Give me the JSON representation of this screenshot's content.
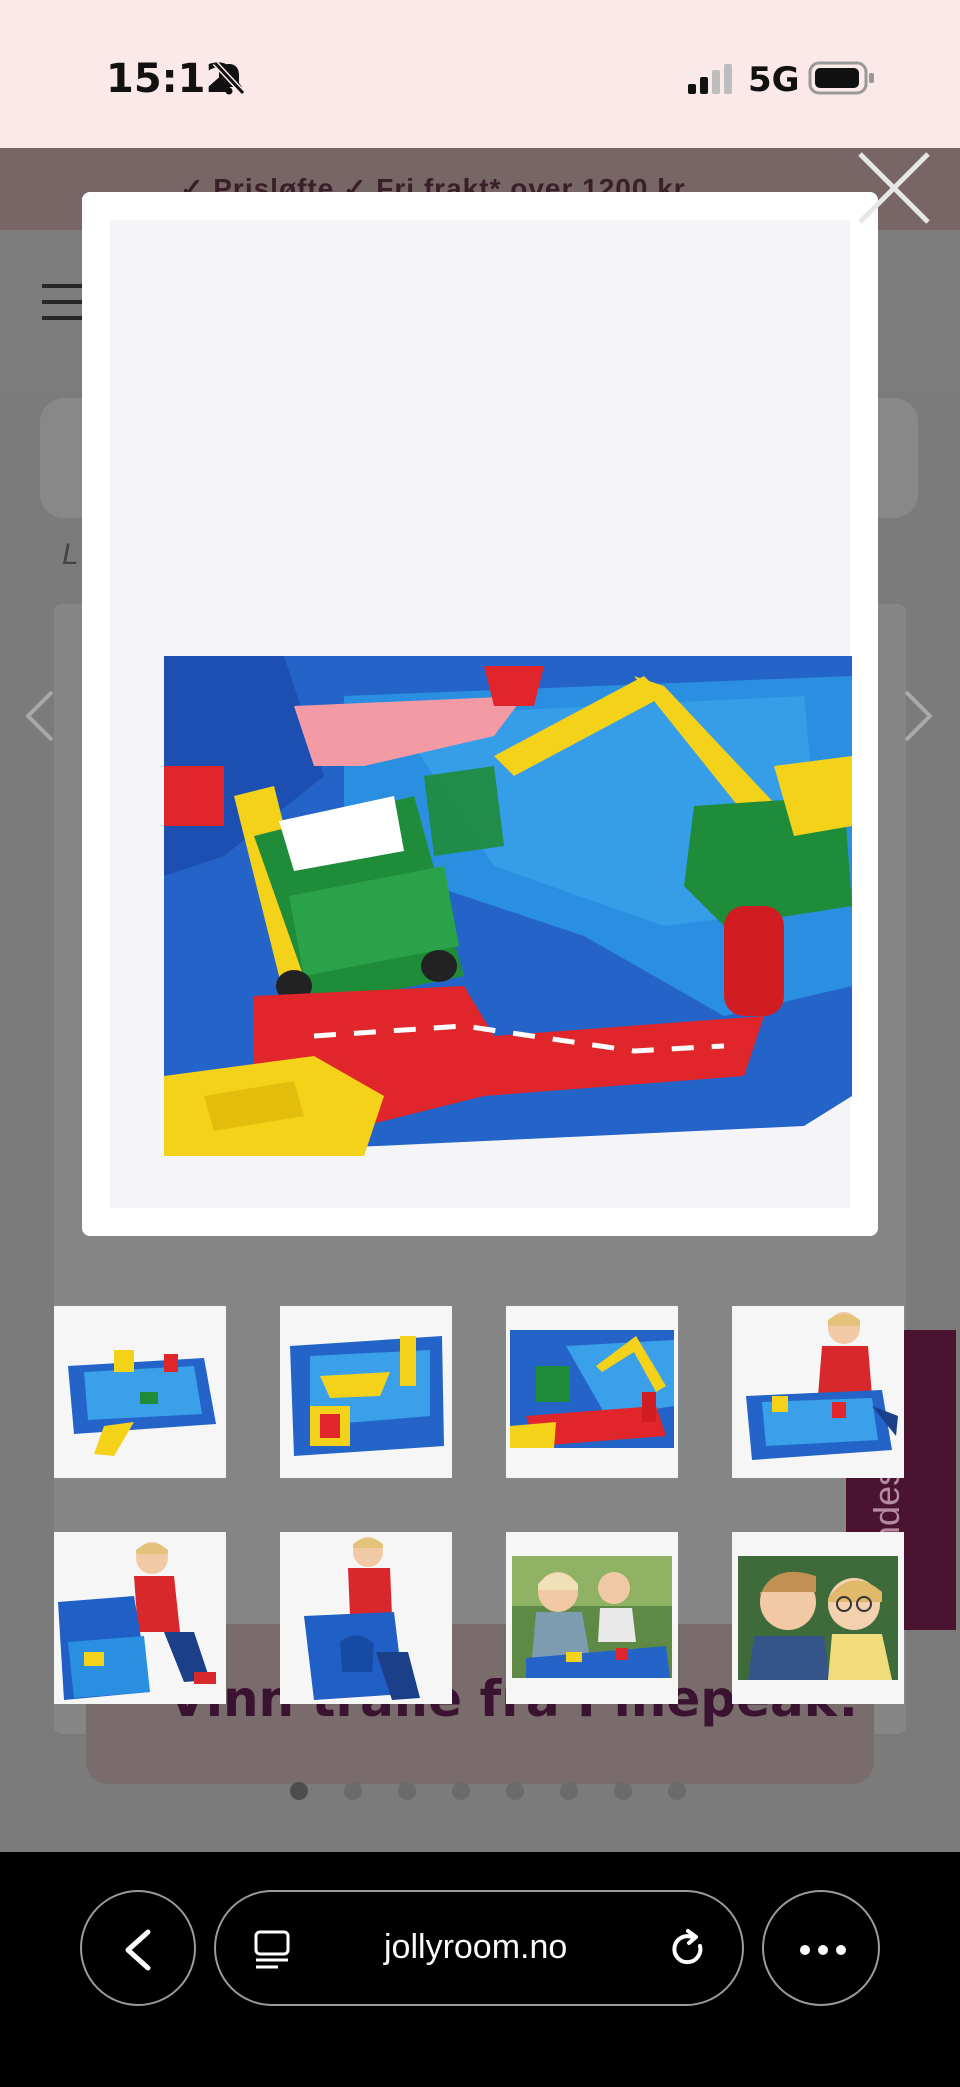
{
  "status_bar": {
    "time": "15:12",
    "network": "5G",
    "icons": [
      "bell-slash-icon",
      "signal-icon",
      "battery-icon"
    ]
  },
  "background_page": {
    "usp_strip": "✓ Prisløfte   ✓ Fri frakt* over 1200 kr",
    "breadcrumb_fragment": "L",
    "promo_banner": "Vinn tralle fra Pinepeak!",
    "side_tab": "Kundeservice",
    "carousel_dots": 8,
    "carousel_active_dot": 1
  },
  "lightbox": {
    "close_icon": "close-icon",
    "main_image": "AquaPlay water play set – close-up with green car, crane and basket",
    "thumbnails": [
      {
        "label": "water-set-overview"
      },
      {
        "label": "water-set-boat-lock"
      },
      {
        "label": "water-set-car-crane"
      },
      {
        "label": "child-playing-set"
      },
      {
        "label": "child-opening-case"
      },
      {
        "label": "child-carrying-case"
      },
      {
        "label": "children-outdoor-play"
      },
      {
        "label": "children-laughing"
      }
    ]
  },
  "browser": {
    "url": "jollyroom.no",
    "icons": [
      "back-icon",
      "tabs-icon",
      "reload-icon",
      "more-icon"
    ]
  },
  "colors": {
    "status_bg": "#fbe9e9",
    "overlay": "#7b7b7b",
    "toy_blue": "#1e63c7",
    "toy_red": "#e0262a",
    "toy_yellow": "#f5d21a",
    "toy_green": "#1f8c3a"
  }
}
